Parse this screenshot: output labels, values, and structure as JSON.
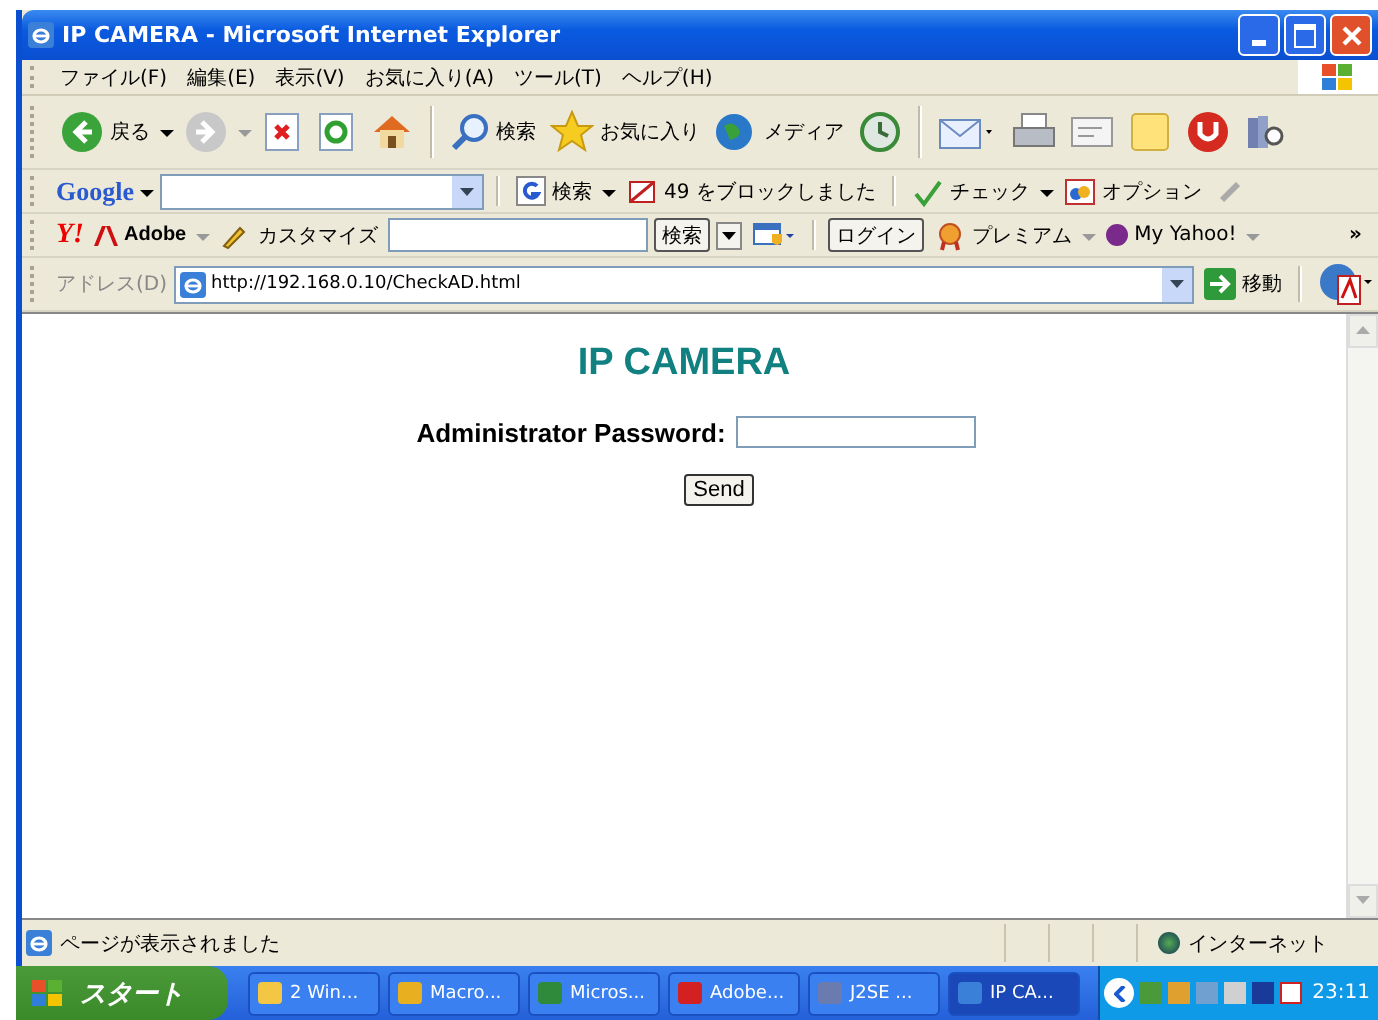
{
  "window": {
    "title": "IP CAMERA - Microsoft Internet Explorer"
  },
  "menu": [
    "ファイル(F)",
    "編集(E)",
    "表示(V)",
    "お気に入り(A)",
    "ツール(T)",
    "ヘルプ(H)"
  ],
  "toolbar": {
    "back": "戻る",
    "search": "検索",
    "favorites": "お気に入り",
    "media": "メディア"
  },
  "google_bar": {
    "logo": "Google",
    "search": "検索",
    "blocked": "49 をブロックしました",
    "check": "チェック",
    "options": "オプション"
  },
  "yahoo_bar": {
    "logo": "Y!",
    "adobe": "Adobe",
    "customize": "カスタマイズ",
    "search": "検索",
    "login": "ログイン",
    "premium": "プレミアム",
    "my_yahoo": "My Yahoo!",
    "more": "»"
  },
  "address_bar": {
    "label": "アドレス(D)",
    "url": "http://192.168.0.10/CheckAD.html",
    "go": "移動"
  },
  "page": {
    "heading": "IP CAMERA",
    "password_label": "Administrator Password:",
    "button": "Send"
  },
  "status_bar": {
    "text": "ページが表示されました",
    "zone": "インターネット"
  },
  "taskbar": {
    "start": "スタート",
    "tasks": [
      {
        "label": "2 Win...",
        "selected": false
      },
      {
        "label": "Macro...",
        "selected": false
      },
      {
        "label": "Micros...",
        "selected": false
      },
      {
        "label": "Adobe...",
        "selected": false
      },
      {
        "label": "J2SE ...",
        "selected": false
      },
      {
        "label": "IP CA...",
        "selected": true
      }
    ],
    "clock": "23:11"
  }
}
